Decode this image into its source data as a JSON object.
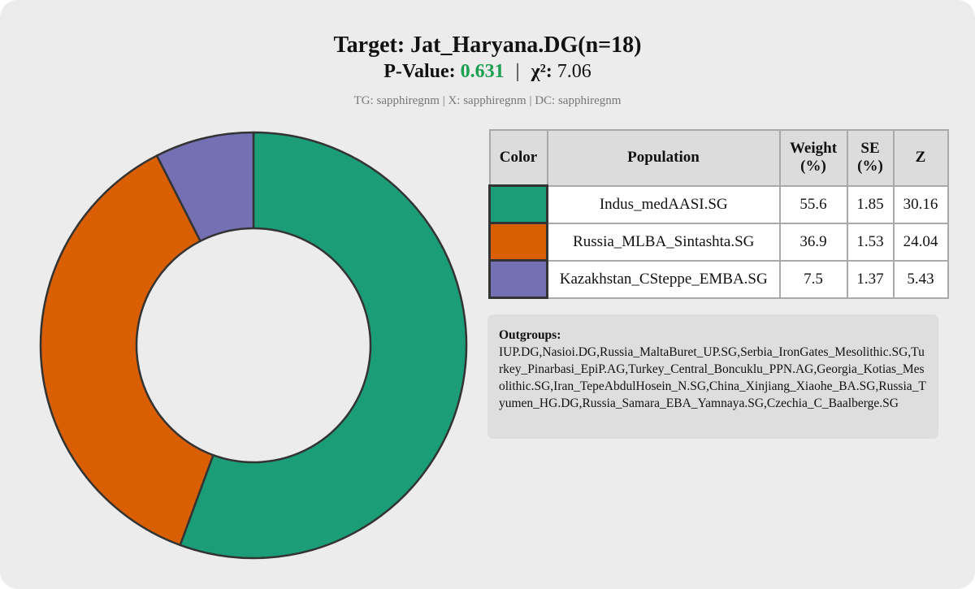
{
  "header": {
    "title": "Target: Jat_Haryana.DG(n=18)",
    "pvalue_label": "P-Value:",
    "pvalue": "0.631",
    "separator": "|",
    "chi_label": "χ²:",
    "chi_value": "7.06",
    "meta": "TG: sapphiregnm | X: sapphiregnm | DC: sapphiregnm"
  },
  "colors": {
    "pvalue": "#1a9e4f",
    "indus": "#1b9e77",
    "russia": "#d95f02",
    "kazakh": "#7570b3",
    "outline": "#333333"
  },
  "table": {
    "headers": [
      "Color",
      "Population",
      "Weight (%)",
      "SE (%)",
      "Z"
    ],
    "rows": [
      {
        "color": "#1b9e77",
        "population": "Indus_medAASI.SG",
        "weight": "55.6",
        "se": "1.85",
        "z": "30.16"
      },
      {
        "color": "#d95f02",
        "population": "Russia_MLBA_Sintashta.SG",
        "weight": "36.9",
        "se": "1.53",
        "z": "24.04"
      },
      {
        "color": "#7570b3",
        "population": "Kazakhstan_CSteppe_EMBA.SG",
        "weight": "7.5",
        "se": "1.37",
        "z": "5.43"
      }
    ]
  },
  "outgroups": {
    "title": "Outgroups:",
    "list": "IUP.DG,Nasioi.DG,Russia_MaltaBuret_UP.SG,Serbia_IronGates_Mesolithic.SG,Turkey_Pinarbasi_EpiP.AG,Turkey_Central_Boncuklu_PPN.AG,Georgia_Kotias_Mesolithic.SG,Iran_TepeAbdulHosein_N.SG,China_Xinjiang_Xiaohe_BA.SG,Russia_Tyumen_HG.DG,Russia_Samara_EBA_Yamnaya.SG,Czechia_C_Baalberge.SG"
  },
  "chart_data": {
    "type": "pie",
    "style": "donut",
    "categories": [
      "Indus_medAASI.SG",
      "Russia_MLBA_Sintashta.SG",
      "Kazakhstan_CSteppe_EMBA.SG"
    ],
    "values": [
      55.6,
      36.9,
      7.5
    ],
    "colors": [
      "#1b9e77",
      "#d95f02",
      "#7570b3"
    ],
    "start": "top",
    "direction": "clockwise"
  }
}
